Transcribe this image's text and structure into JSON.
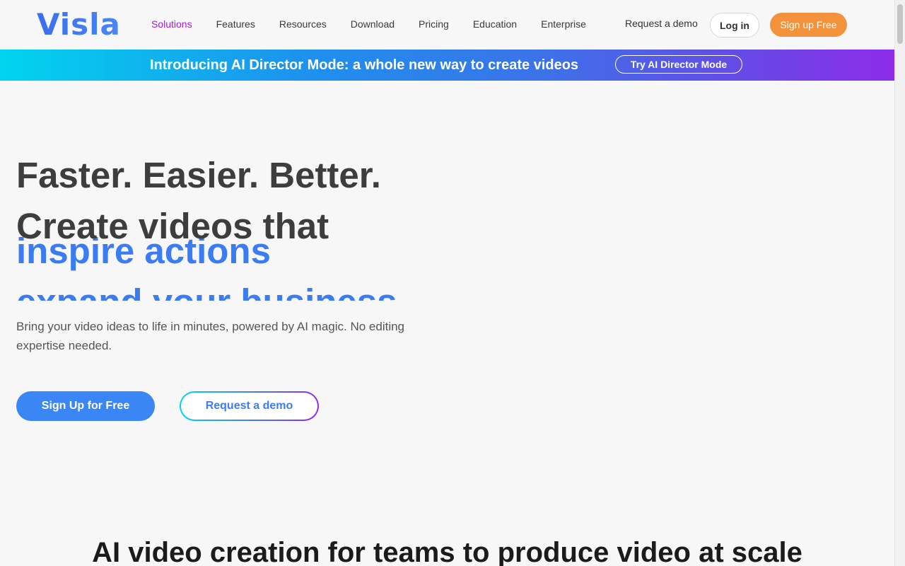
{
  "header": {
    "logo": "Visla",
    "nav": [
      "Solutions",
      "Features",
      "Resources",
      "Download",
      "Pricing",
      "Education",
      "Enterprise"
    ],
    "active_index": 0,
    "request_demo": "Request a demo",
    "login": "Log in",
    "signup": "Sign up Free"
  },
  "banner": {
    "text": "Introducing AI Director Mode: a whole new way to create videos",
    "button": "Try AI Director Mode"
  },
  "hero": {
    "line1": "Faster. Easier. Better.",
    "line2": "Create videos that",
    "rotating": [
      "inspire actions",
      "expand your business"
    ],
    "subtitle": "Bring your video ideas to life in minutes, powered by AI magic. No editing expertise needed.",
    "primary_cta": "Sign Up for Free",
    "secondary_cta": "Request a demo"
  },
  "section": {
    "title": "AI video creation for teams to produce video at scale"
  },
  "colors": {
    "accent_blue": "#3a86f5",
    "accent_orange": "#f2923a",
    "active_purple": "#a21fd6"
  }
}
